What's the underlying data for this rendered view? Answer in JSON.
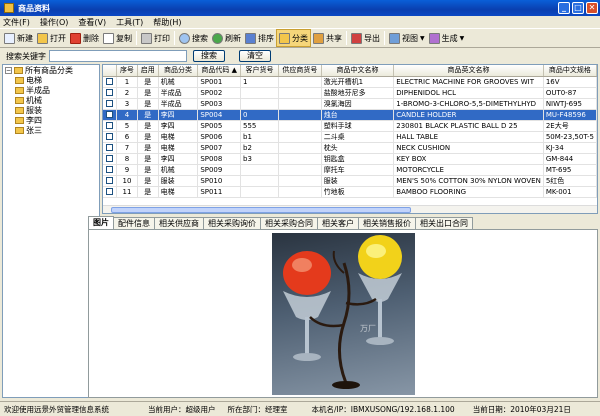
{
  "window": {
    "title": "商品资料"
  },
  "menu": [
    "文件(F)",
    "操作(O)",
    "查看(V)",
    "工具(T)",
    "帮助(H)"
  ],
  "toolbar": {
    "new": "新建",
    "open": "打开",
    "delete": "删除",
    "copy": "复制",
    "print": "打印",
    "search": "搜索",
    "refresh": "刷新",
    "sort": "排序",
    "category": "分类",
    "share": "共享",
    "export": "导出",
    "view": "视图",
    "generate": "生成"
  },
  "search": {
    "label": "搜索关键字",
    "value": "",
    "button": "搜索",
    "clear": "清空"
  },
  "tree": {
    "root": "所有商品分类",
    "items": [
      "电梯",
      "半成品",
      "机械",
      "服装",
      "李四",
      "张三"
    ]
  },
  "grid": {
    "columns": [
      "",
      "序号",
      "启用",
      "商品分类",
      "商品代码",
      "客户货号",
      "供应商货号",
      "商品中文名称",
      "商品英文名称",
      "商品中文规格"
    ],
    "rows": [
      {
        "no": "1",
        "enabled": "是",
        "category": "机械",
        "code": "SP001",
        "cust": "1",
        "supp": "",
        "cn": "激光开槽机1",
        "en": "ELECTRIC MACHINE FOR GROOVES WIT",
        "spec": "16V"
      },
      {
        "no": "2",
        "enabled": "是",
        "category": "半成品",
        "code": "SP002",
        "cust": "",
        "supp": "",
        "cn": "盐酸地芬尼多",
        "en": "DIPHENIDOL HCL",
        "spec": "OUT0-87"
      },
      {
        "no": "3",
        "enabled": "是",
        "category": "半成品",
        "code": "SP003",
        "cust": "",
        "supp": "",
        "cn": "溴氯海因",
        "en": "1-BROMO-3-CHLORO-5,5-DIMETHYLHYD",
        "spec": "NIWTJ-695"
      },
      {
        "no": "4",
        "enabled": "是",
        "category": "李四",
        "code": "SP004",
        "cust": "0",
        "supp": "",
        "cn": "烛台",
        "en": "CANDLE HOLDER",
        "spec": "MU-F48596"
      },
      {
        "no": "5",
        "enabled": "是",
        "category": "李四",
        "code": "SP005",
        "cust": "555",
        "supp": "",
        "cn": "塑料手球",
        "en": "230801 BLACK PLASTIC BALL D 25",
        "spec": "2E大号"
      },
      {
        "no": "6",
        "enabled": "是",
        "category": "电梯",
        "code": "SP006",
        "cust": "b1",
        "supp": "",
        "cn": "二斗桌",
        "en": "HALL TABLE",
        "spec": "50M-23,50T-5"
      },
      {
        "no": "7",
        "enabled": "是",
        "category": "电梯",
        "code": "SP007",
        "cust": "b2",
        "supp": "",
        "cn": "枕头",
        "en": "NECK CUSHION",
        "spec": "KJ-34"
      },
      {
        "no": "8",
        "enabled": "是",
        "category": "李四",
        "code": "SP008",
        "cust": "b3",
        "supp": "",
        "cn": "钥匙盒",
        "en": "KEY BOX",
        "spec": "GM-844"
      },
      {
        "no": "9",
        "enabled": "是",
        "category": "机械",
        "code": "SP009",
        "cust": "",
        "supp": "",
        "cn": "摩托车",
        "en": "MOTORCYCLE",
        "spec": "MT-695"
      },
      {
        "no": "10",
        "enabled": "是",
        "category": "服装",
        "code": "SP010",
        "cust": "",
        "supp": "",
        "cn": "服装",
        "en": "MEN'S 50% COTTON 30% NYLON WOVEN",
        "spec": "5红色"
      },
      {
        "no": "11",
        "enabled": "是",
        "category": "电梯",
        "code": "SP011",
        "cust": "",
        "supp": "",
        "cn": "竹地板",
        "en": "BAMBOO FLOORING",
        "spec": "MK-001"
      }
    ],
    "selected_row": 4
  },
  "tabs": [
    "图片",
    "配件信息",
    "相关供应商",
    "相关采购询价",
    "相关采购合同",
    "相关客户",
    "相关销售报价",
    "相关出口合同"
  ],
  "status": {
    "welcome": "欢迎使用远景外贸管理信息系统",
    "user_label": "当前用户：",
    "user": "超级用户",
    "dept_label": "所在部门：",
    "dept": "经理室",
    "host": "本机名/IP：IBMXUSONG/192.168.1.100",
    "date_label": "当前日期：",
    "date": "2010年03月21日"
  },
  "photo_watermark": "万厂"
}
